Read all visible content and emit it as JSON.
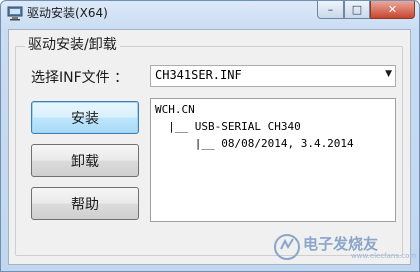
{
  "window": {
    "title": "驱动安装(X64)",
    "controls": {
      "minimize": "–",
      "maximize": "□",
      "close": "✕"
    }
  },
  "group": {
    "label": "驱动安装/卸载"
  },
  "inf_select": {
    "label": "选择INF文件 ：",
    "value": "CH341SER.INF"
  },
  "buttons": {
    "install": "安装",
    "uninstall": "卸载",
    "help": "帮助"
  },
  "info_box": {
    "lines": [
      "WCH.CN",
      "  |__ USB-SERIAL CH340",
      "      |__ 08/08/2014, 3.4.2014"
    ]
  },
  "watermark": {
    "text": "电子发烧友",
    "url": "www.elecfans.com"
  }
}
